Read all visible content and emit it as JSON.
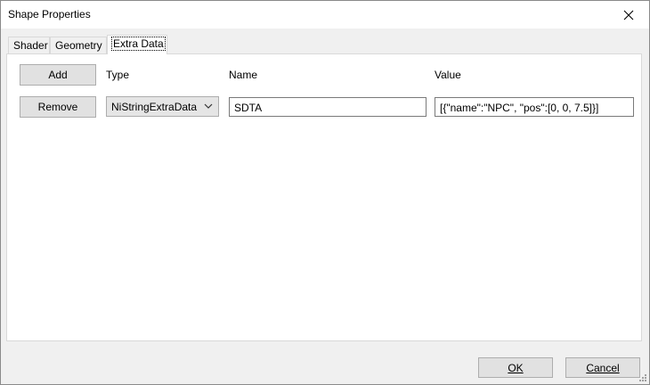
{
  "window": {
    "title": "Shape Properties"
  },
  "tabs": [
    {
      "label": "Shader",
      "active": false
    },
    {
      "label": "Geometry",
      "active": false
    },
    {
      "label": "Extra Data",
      "active": true
    }
  ],
  "extra_data": {
    "add_label": "Add",
    "columns": {
      "type": "Type",
      "name": "Name",
      "value": "Value"
    },
    "rows": [
      {
        "remove_label": "Remove",
        "type": "NiStringExtraData",
        "name": "SDTA",
        "value": "[{\"name\":\"NPC\", \"pos\":[0, 0, 7.5]}]"
      }
    ]
  },
  "footer": {
    "ok_label": "OK",
    "cancel_label": "Cancel"
  },
  "icons": {
    "close": "close-icon",
    "dropdown": "chevron-down-icon",
    "resize": "resize-grip-icon"
  }
}
